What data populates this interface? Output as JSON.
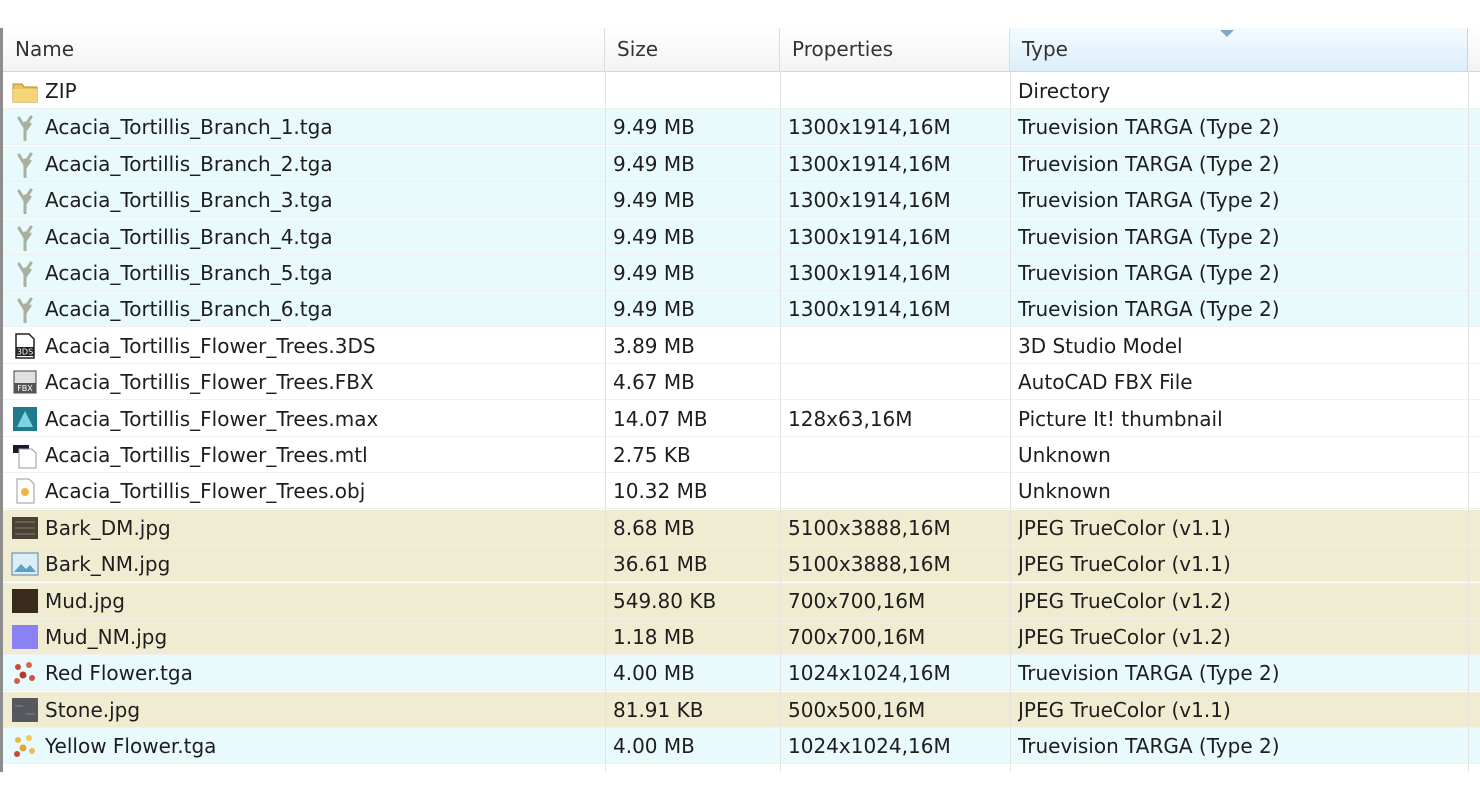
{
  "columns": {
    "name": "Name",
    "size": "Size",
    "properties": "Properties",
    "type": "Type"
  },
  "files": [
    {
      "name": "ZIP",
      "size": "",
      "properties": "",
      "type": "Directory",
      "icon": "folder-icon",
      "tint": "white"
    },
    {
      "name": "Acacia_Tortillis_Branch_1.tga",
      "size": "9.49 MB",
      "properties": "1300x1914,16M",
      "type": "Truevision TARGA (Type 2)",
      "icon": "branch-thumbnail-icon",
      "tint": "cyan"
    },
    {
      "name": "Acacia_Tortillis_Branch_2.tga",
      "size": "9.49 MB",
      "properties": "1300x1914,16M",
      "type": "Truevision TARGA (Type 2)",
      "icon": "branch-thumbnail-icon",
      "tint": "cyan"
    },
    {
      "name": "Acacia_Tortillis_Branch_3.tga",
      "size": "9.49 MB",
      "properties": "1300x1914,16M",
      "type": "Truevision TARGA (Type 2)",
      "icon": "branch-thumbnail-icon",
      "tint": "cyan"
    },
    {
      "name": "Acacia_Tortillis_Branch_4.tga",
      "size": "9.49 MB",
      "properties": "1300x1914,16M",
      "type": "Truevision TARGA (Type 2)",
      "icon": "branch-thumbnail-icon",
      "tint": "cyan"
    },
    {
      "name": "Acacia_Tortillis_Branch_5.tga",
      "size": "9.49 MB",
      "properties": "1300x1914,16M",
      "type": "Truevision TARGA (Type 2)",
      "icon": "branch-thumbnail-icon",
      "tint": "cyan"
    },
    {
      "name": "Acacia_Tortillis_Branch_6.tga",
      "size": "9.49 MB",
      "properties": "1300x1914,16M",
      "type": "Truevision TARGA (Type 2)",
      "icon": "branch-thumbnail-icon",
      "tint": "cyan"
    },
    {
      "name": "Acacia_Tortillis_Flower_Trees.3DS",
      "size": "3.89 MB",
      "properties": "",
      "type": "3D Studio Model",
      "icon": "3ds-file-icon",
      "tint": "white"
    },
    {
      "name": "Acacia_Tortillis_Flower_Trees.FBX",
      "size": "4.67 MB",
      "properties": "",
      "type": "AutoCAD FBX File",
      "icon": "fbx-file-icon",
      "tint": "white"
    },
    {
      "name": "Acacia_Tortillis_Flower_Trees.max",
      "size": "14.07 MB",
      "properties": "128x63,16M",
      "type": "Picture It! thumbnail",
      "icon": "max-file-icon",
      "tint": "white"
    },
    {
      "name": "Acacia_Tortillis_Flower_Trees.mtl",
      "size": "2.75 KB",
      "properties": "",
      "type": "Unknown",
      "icon": "mtl-file-icon",
      "tint": "white"
    },
    {
      "name": "Acacia_Tortillis_Flower_Trees.obj",
      "size": "10.32 MB",
      "properties": "",
      "type": "Unknown",
      "icon": "obj-file-icon",
      "tint": "white"
    },
    {
      "name": "Bark_DM.jpg",
      "size": "8.68 MB",
      "properties": "5100x3888,16M",
      "type": "JPEG TrueColor (v1.1)",
      "icon": "bark-thumbnail-icon",
      "tint": "tan"
    },
    {
      "name": "Bark_NM.jpg",
      "size": "36.61 MB",
      "properties": "5100x3888,16M",
      "type": "JPEG TrueColor (v1.1)",
      "icon": "image-file-icon",
      "tint": "tan"
    },
    {
      "name": "Mud.jpg",
      "size": "549.80 KB",
      "properties": "700x700,16M",
      "type": "JPEG TrueColor (v1.2)",
      "icon": "mud-thumbnail-icon",
      "tint": "tan"
    },
    {
      "name": "Mud_NM.jpg",
      "size": "1.18 MB",
      "properties": "700x700,16M",
      "type": "JPEG TrueColor (v1.2)",
      "icon": "normal-map-thumbnail-icon",
      "tint": "tan"
    },
    {
      "name": "Red Flower.tga",
      "size": "4.00 MB",
      "properties": "1024x1024,16M",
      "type": "Truevision TARGA (Type 2)",
      "icon": "red-flower-thumbnail-icon",
      "tint": "cyan"
    },
    {
      "name": "Stone.jpg",
      "size": "81.91 KB",
      "properties": "500x500,16M",
      "type": "JPEG TrueColor (v1.1)",
      "icon": "stone-thumbnail-icon",
      "tint": "tan"
    },
    {
      "name": "Yellow Flower.tga",
      "size": "4.00 MB",
      "properties": "1024x1024,16M",
      "type": "Truevision TARGA (Type 2)",
      "icon": "yellow-flower-thumbnail-icon",
      "tint": "cyan"
    }
  ]
}
